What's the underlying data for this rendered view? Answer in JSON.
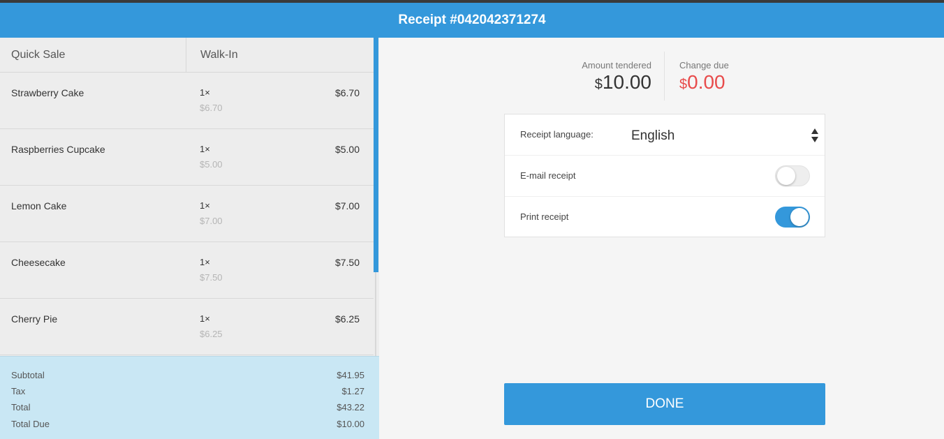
{
  "header": {
    "title": "Receipt #042042371274"
  },
  "tabs": {
    "quick_sale": "Quick Sale",
    "walk_in": "Walk-In"
  },
  "items": [
    {
      "name": "Strawberry Cake",
      "qty": "1×",
      "unit_price": "$6.70",
      "price": "$6.70"
    },
    {
      "name": "Raspberries Cupcake",
      "qty": "1×",
      "unit_price": "$5.00",
      "price": "$5.00"
    },
    {
      "name": "Lemon Cake",
      "qty": "1×",
      "unit_price": "$7.00",
      "price": "$7.00"
    },
    {
      "name": "Cheesecake",
      "qty": "1×",
      "unit_price": "$7.50",
      "price": "$7.50"
    },
    {
      "name": "Cherry Pie",
      "qty": "1×",
      "unit_price": "$6.25",
      "price": "$6.25"
    }
  ],
  "totals": {
    "subtotal_label": "Subtotal",
    "subtotal": "$41.95",
    "tax_label": "Tax",
    "tax": "$1.27",
    "total_label": "Total",
    "total": "$43.22",
    "due_label": "Total Due",
    "due": "$10.00"
  },
  "payment": {
    "tendered_label": "Amount tendered",
    "tendered_currency": "$",
    "tendered_amount": "10.00",
    "change_label": "Change due",
    "change_currency": "$",
    "change_amount": "0.00"
  },
  "options": {
    "language_label": "Receipt language:",
    "language_value": "English",
    "email_label": "E-mail receipt",
    "email_enabled": false,
    "print_label": "Print receipt",
    "print_enabled": true
  },
  "done_label": "DONE",
  "colors": {
    "accent": "#3498db",
    "change_due": "#e84b4b",
    "totals_bg": "#c9e7f4"
  }
}
